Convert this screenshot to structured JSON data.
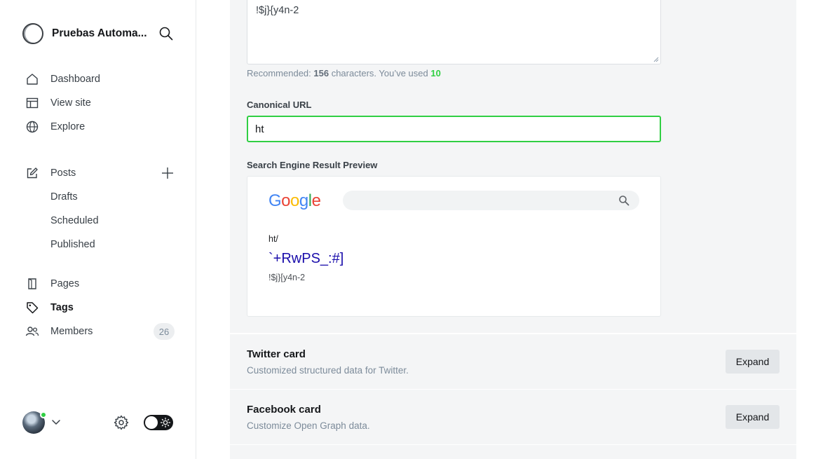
{
  "sidebar": {
    "brand_name": "Pruebas Automa...",
    "nav_primary": [
      {
        "label": "Dashboard",
        "icon": "home-icon"
      },
      {
        "label": "View site",
        "icon": "layout-icon"
      },
      {
        "label": "Explore",
        "icon": "globe-icon"
      }
    ],
    "posts": {
      "label": "Posts",
      "icon": "pencil-icon",
      "sub_items": [
        "Drafts",
        "Scheduled",
        "Published"
      ]
    },
    "nav_secondary": [
      {
        "label": "Pages",
        "icon": "page-icon"
      },
      {
        "label": "Tags",
        "icon": "tag-icon",
        "active": true
      },
      {
        "label": "Members",
        "icon": "members-icon",
        "count": "26"
      }
    ],
    "status_color": "#30cf43"
  },
  "editor": {
    "meta_description_value": "!$j}{y4n-2",
    "hint": {
      "prefix": "Recommended: ",
      "recommended": "156",
      "middle": " characters. You’ve used ",
      "used": "10"
    },
    "canonical_label": "Canonical URL",
    "canonical_value": "ht",
    "serp_label": "Search Engine Result Preview",
    "serp": {
      "logo_text": "Google",
      "url": "ht/",
      "title": "`+RwPS_:#]",
      "description": "!$j}[y4n-2"
    }
  },
  "cards": [
    {
      "title": "Twitter card",
      "subtitle": "Customized structured data for Twitter.",
      "button": "Expand"
    },
    {
      "title": "Facebook card",
      "subtitle": "Customize Open Graph data.",
      "button": "Expand"
    }
  ],
  "colors": {
    "accent_green": "#30cf43",
    "serp_title": "#1a0dab",
    "panel_bg": "#f4f5f6"
  }
}
